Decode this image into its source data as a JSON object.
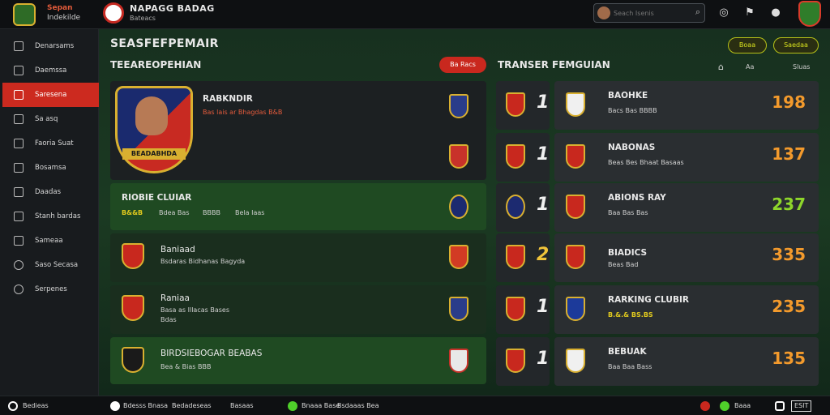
{
  "app": {
    "brand_line1": "Sepan",
    "brand_line2": "Indekilde",
    "club_name": "NAPAGG BADAG",
    "club_sub": "Bateacs"
  },
  "search": {
    "placeholder": "Seach Isenis"
  },
  "icons": [
    "globe-icon",
    "trophy-icon",
    "ball-icon"
  ],
  "sidebar": {
    "items": [
      {
        "label": "Denarsams",
        "icon": "home-icon"
      },
      {
        "label": "Daemssa",
        "icon": "list-icon"
      },
      {
        "label": "Saresena",
        "icon": "user-icon",
        "active": true
      },
      {
        "label": "Sa asq",
        "icon": "shield-icon"
      },
      {
        "label": "Faoria Suat",
        "icon": "settings-icon"
      },
      {
        "label": "Bosamsa",
        "icon": "chart-icon"
      },
      {
        "label": "Daadas",
        "icon": "calendar-icon"
      },
      {
        "label": "Stanh bardas",
        "icon": "stats-icon"
      },
      {
        "label": "Sameaa",
        "icon": "ball-icon"
      },
      {
        "label": "Saso Secasa",
        "icon": "clock-icon"
      },
      {
        "label": "Serpenes",
        "icon": "speech-icon"
      }
    ]
  },
  "header": {
    "page_title": "SEASFEFPEMAIR",
    "left_title": "TEEAREOPEHIAN",
    "red_pill": "Ba Racs",
    "right_title": "TRANSER FEMGUIAN",
    "pill_1": "Boaa",
    "pill_2": "Saedaa",
    "tool_text": "Aa",
    "tool_text_2": "Sluas"
  },
  "left_cards": [
    {
      "name": "RABKNDIR",
      "meta": "Bas lais ar Bhagdas B&B",
      "banner": "BEADABHDA"
    },
    {
      "name": "RIOBIE CLUIAR",
      "meta_a": "B&&B",
      "meta_b": "Bdea Bas",
      "meta_c": "BBBB",
      "meta_d": "Bela Iaas"
    },
    {
      "name": "Baniaad",
      "meta": "Bsdaras Bidhanas Bagyda"
    },
    {
      "name": "Raniaa",
      "meta": "Basa as Illacas Bases",
      "meta_b": "Bdas"
    },
    {
      "name": "BIRDSIEBOGAR BEABAS",
      "meta": "Bea & Bias BBB"
    }
  ],
  "ranking": [
    {
      "rank": "1",
      "name": "BAOHKE",
      "meta": "Bacs Bas BBBB",
      "score": "198",
      "score_color": "#f39a2c"
    },
    {
      "name": "NABONAS",
      "rank": "1",
      "meta": "Beas Bes Bhaat Basaas",
      "score": "137",
      "score_color": "#f39a2c"
    },
    {
      "name": "ABIONS RAY",
      "rank": "1",
      "meta": "Baa Bas Bas",
      "score": "237",
      "score_color": "#8ed62b"
    },
    {
      "name": "BIADICS",
      "rank": "2",
      "meta": "Beas Bad",
      "score": "335",
      "score_color": "#f39a2c"
    },
    {
      "name": "RARKING CLUBIR",
      "rank": "1",
      "meta": "B.&.& BS.BS",
      "score": "235",
      "score_color": "#f39a2c"
    },
    {
      "name": "BEBUAK",
      "rank": "1",
      "meta": "Baa Baa Bass",
      "score": "135",
      "score_color": "#f39a2c"
    }
  ],
  "bottom": {
    "left": "Bedieas",
    "seg1": "Bdesss Bnasa",
    "seg2": "Bedadeseas",
    "seg3": "Basaas",
    "seg4": "Bnaaa Base",
    "seg5": "Bsdaaas Bea",
    "right1": "Baaa",
    "right2": "ESIT"
  }
}
